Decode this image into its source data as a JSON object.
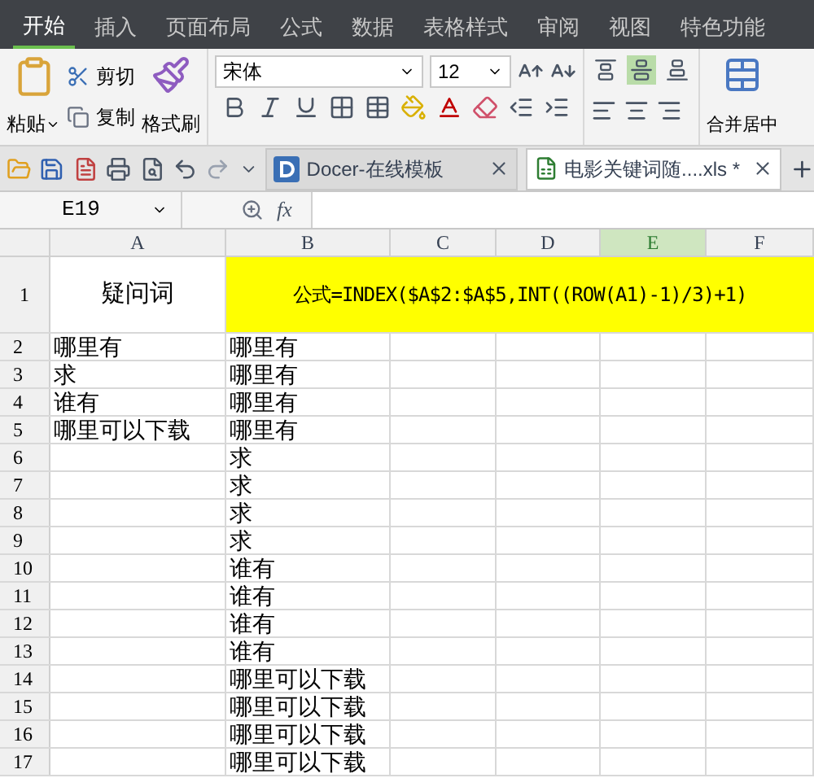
{
  "menu_tabs": [
    {
      "label": "开始",
      "selected": true
    },
    {
      "label": "插入",
      "selected": false
    },
    {
      "label": "页面布局",
      "selected": false
    },
    {
      "label": "公式",
      "selected": false
    },
    {
      "label": "数据",
      "selected": false
    },
    {
      "label": "表格样式",
      "selected": false
    },
    {
      "label": "审阅",
      "selected": false
    },
    {
      "label": "视图",
      "selected": false
    },
    {
      "label": "特色功能",
      "selected": false
    }
  ],
  "ribbon": {
    "paste": "粘贴",
    "cut": "剪切",
    "copy": "复制",
    "format_painter": "格式刷",
    "font_name": "宋体",
    "font_size": "12",
    "merge": "合并居中",
    "align_buttons": [
      {
        "kind": "top",
        "selected": false
      },
      {
        "kind": "middle",
        "selected": true
      },
      {
        "kind": "bottom",
        "selected": false
      }
    ]
  },
  "doc_tabs": [
    {
      "label": "Docer-在线模板",
      "kind": "docer",
      "selected": false
    },
    {
      "label": "电影关键词随....xls *",
      "kind": "sheet",
      "selected": true
    }
  ],
  "name_box": "E19",
  "fx": "fx",
  "columns": [
    {
      "label": "A",
      "selected": false
    },
    {
      "label": "B",
      "selected": false
    },
    {
      "label": "C",
      "selected": false
    },
    {
      "label": "D",
      "selected": false
    },
    {
      "label": "E",
      "selected": true
    },
    {
      "label": "F",
      "selected": false
    }
  ],
  "header_row": {
    "number": "1",
    "a": "疑问词",
    "formula": "公式=INDEX($A$2:$A$5,INT((ROW(A1)-1)/3)+1)"
  },
  "rows": [
    {
      "number": "2",
      "a": "哪里有",
      "b": "哪里有"
    },
    {
      "number": "3",
      "a": "求",
      "b": "哪里有"
    },
    {
      "number": "4",
      "a": "谁有",
      "b": "哪里有"
    },
    {
      "number": "5",
      "a": "哪里可以下载",
      "b": "哪里有"
    },
    {
      "number": "6",
      "b": "求"
    },
    {
      "number": "7",
      "b": "求"
    },
    {
      "number": "8",
      "b": "求"
    },
    {
      "number": "9",
      "b": "求"
    },
    {
      "number": "10",
      "b": "谁有"
    },
    {
      "number": "11",
      "b": "谁有"
    },
    {
      "number": "12",
      "b": "谁有"
    },
    {
      "number": "13",
      "b": "谁有"
    },
    {
      "number": "14",
      "b": "哪里可以下载"
    },
    {
      "number": "15",
      "b": "哪里可以下载"
    },
    {
      "number": "16",
      "b": "哪里可以下载"
    },
    {
      "number": "17",
      "b": "哪里可以下载"
    }
  ]
}
